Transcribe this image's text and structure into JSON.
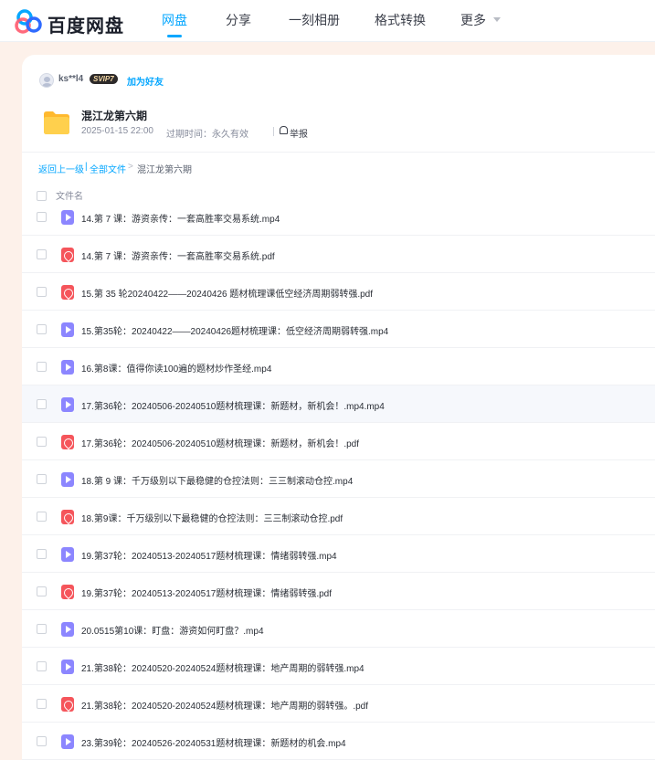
{
  "brand": {
    "name": "百度网盘"
  },
  "nav": {
    "items": [
      "网盘",
      "分享",
      "一刻相册",
      "格式转换",
      "更多"
    ],
    "active_index": 0
  },
  "sharer": {
    "username": "ks**l4",
    "vip": "SVIP7",
    "add_friend": "加为好友"
  },
  "share": {
    "title": "混江龙第六期",
    "created": "2025-01-15 22:00",
    "expiry": "过期时间：永久有效",
    "report": "举报"
  },
  "breadcrumb": {
    "back": "返回上一级",
    "sep1": "|",
    "all": "全部文件",
    "sep2": ">",
    "current": "混江龙第六期"
  },
  "table": {
    "column": "文件名"
  },
  "files": [
    {
      "name": "14.第 7 课：游资亲传：一套高胜率交易系统.mp4",
      "type": "video"
    },
    {
      "name": "14.第 7 课：游资亲传：一套高胜率交易系统.pdf",
      "type": "pdf"
    },
    {
      "name": "15.第 35 轮20240422——20240426 题材梳理课低空经济周期弱转强.pdf",
      "type": "pdf"
    },
    {
      "name": "15.第35轮：20240422——20240426题材梳理课：低空经济周期弱转强.mp4",
      "type": "video"
    },
    {
      "name": "16.第8课：值得你读100遍的题材炒作圣经.mp4",
      "type": "video"
    },
    {
      "name": "17.第36轮：20240506-20240510题材梳理课：新题材，新机会！.mp4.mp4",
      "type": "video"
    },
    {
      "name": "17.第36轮：20240506-20240510题材梳理课：新题材，新机会！.pdf",
      "type": "pdf"
    },
    {
      "name": "18.第 9 课：千万级别以下最稳健的仓控法则：三三制滚动仓控.mp4",
      "type": "video"
    },
    {
      "name": "18.第9课：千万级别以下最稳健的仓控法则：三三制滚动仓控.pdf",
      "type": "pdf"
    },
    {
      "name": "19.第37轮：20240513-20240517题材梳理课：情绪弱转强.mp4",
      "type": "video"
    },
    {
      "name": "19.第37轮：20240513-20240517题材梳理课：情绪弱转强.pdf",
      "type": "pdf"
    },
    {
      "name": "20.0515第10课：盯盘：游资如何盯盘？.mp4",
      "type": "video"
    },
    {
      "name": "21.第38轮：20240520-20240524题材梳理课：地产周期的弱转强.mp4",
      "type": "video"
    },
    {
      "name": "21.第38轮：20240520-20240524题材梳理课：地产周期的弱转强。.pdf",
      "type": "pdf"
    },
    {
      "name": "23.第39轮：20240526-20240531题材梳理课：新题材的机会.mp4",
      "type": "video"
    }
  ],
  "hover_row_index": 5,
  "colors": {
    "accent": "#06a7ff",
    "background": "#fdf1ea",
    "video": "#8c86ff",
    "pdf": "#f5555b",
    "folder": "#ffc933"
  }
}
